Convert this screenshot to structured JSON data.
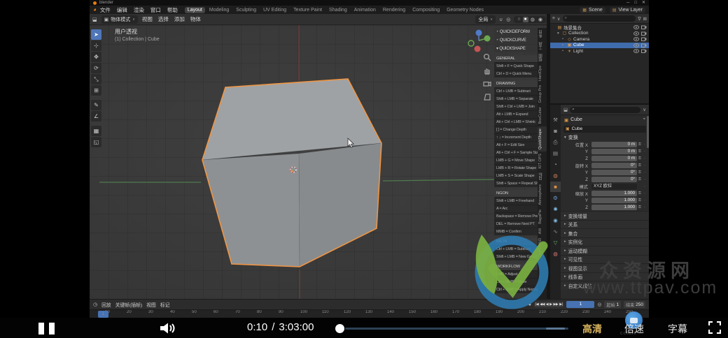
{
  "colors": {
    "accent_blue": "#4772b3",
    "selection_orange": "#ef9544",
    "axis_green": "#4f7a4f",
    "axis_red": "#703c3c",
    "hd_gold": "#d8b35c",
    "logo_blue": "#2e7db3",
    "logo_green": "#7cb342",
    "watermark_gray": "#3d3d3d"
  },
  "player": {
    "time_current": "0:10",
    "time_separator": "/",
    "time_total": "3:03:00",
    "hd_label": "高清",
    "speed_label": "倍速",
    "subtitles_label": "字幕",
    "cctalk_label": "cctalk"
  },
  "watermark": {
    "site_name": "众资源网",
    "site_url": "www.ttpav.com"
  },
  "blender": {
    "window": {
      "title": "blender",
      "buttons": [
        "─",
        "□",
        "✕"
      ]
    },
    "topbar": {
      "menus": [
        "文件",
        "编辑",
        "渲染",
        "窗口",
        "帮助"
      ],
      "workspaces": [
        {
          "label": "Layout",
          "cls": "active"
        },
        {
          "label": "Modeling"
        },
        {
          "label": "Sculpting"
        },
        {
          "label": "UV Editing"
        },
        {
          "label": "Texture Paint"
        },
        {
          "label": "Shading"
        },
        {
          "label": "Animation"
        },
        {
          "label": "Rendering"
        },
        {
          "label": "Compositing"
        },
        {
          "label": "Geometry Nodes"
        }
      ],
      "scene_label": "Scene",
      "view_layer_label": "View Layer"
    },
    "viewport_header": {
      "mode_label": "物体模式",
      "menus": [
        "视图",
        "选择",
        "添加",
        "物体"
      ],
      "orientation_label": "全局",
      "shading": [
        {
          "g": "○"
        },
        {
          "g": "●",
          "cls": "active"
        },
        {
          "g": "◍"
        },
        {
          "g": "◉"
        }
      ]
    },
    "viewport": {
      "overlay_line1": "用户透视",
      "overlay_line2": "(1) Collection | Cube",
      "tools": [
        {
          "g": "➤",
          "cls": "active"
        },
        {
          "g": "⊹"
        },
        {
          "g": "✥"
        },
        {
          "g": "⟳"
        },
        {
          "g": "⤡"
        },
        {
          "g": "⊞"
        },
        {
          "g": "✎",
          "cls": "gap"
        },
        {
          "g": "∠"
        },
        {
          "g": "▦",
          "cls": "gap"
        },
        {
          "g": "◱"
        }
      ]
    },
    "npanel": {
      "entries": [
        {
          "k": "tab",
          "t": "QUICKDEFORM"
        },
        {
          "k": "tab",
          "t": "QUICKCURVE"
        },
        {
          "k": "tabopen",
          "t": "QUICKSHAPE"
        },
        {
          "k": "h",
          "t": "GENERAL"
        },
        {
          "k": "i",
          "t": "Shift + F = Quick Shape"
        },
        {
          "k": "i",
          "t": "Ctrl + D = Quick Menu"
        },
        {
          "k": "h",
          "t": "DRAWING"
        },
        {
          "k": "i",
          "t": "Ctrl + LMB = Subtract"
        },
        {
          "k": "i",
          "t": "Shift + LMB = Separate"
        },
        {
          "k": "i",
          "t": "Shift + Ctrl + LMB = Join"
        },
        {
          "k": "i",
          "t": "Alt + LMB = Expand"
        },
        {
          "k": "i",
          "t": "Alt + Ctrl + LMB = Shrink"
        },
        {
          "k": "i",
          "t": "[ ] = Change Depth"
        },
        {
          "k": "i",
          "t": "↑ ↓ = Increment Depth"
        },
        {
          "k": "i",
          "t": "Alt + F = Edit Size"
        },
        {
          "k": "i",
          "t": "Alt + Ctrl + F = Sample Size"
        },
        {
          "k": "i",
          "t": "LMB + G = Move Shape"
        },
        {
          "k": "i",
          "t": "LMB + R = Rotate Shape"
        },
        {
          "k": "i",
          "t": "LMB + S = Scale Shape"
        },
        {
          "k": "i",
          "t": "Shift + Space = Repeat Shape"
        },
        {
          "k": "h",
          "t": "NGON"
        },
        {
          "k": "i",
          "t": "Shift + LMB = Freehand"
        },
        {
          "k": "i",
          "t": "A = Arc"
        },
        {
          "k": "i",
          "t": "Backspace = Remove Prev PT"
        },
        {
          "k": "i",
          "t": "DEL = Remove Next PT"
        },
        {
          "k": "i",
          "t": "MMB = Confirm"
        },
        {
          "k": "h",
          "t": "META"
        },
        {
          "k": "i",
          "t": "Ctrl + LMB = Subtract"
        },
        {
          "k": "i",
          "t": "Shift + LMB = New Group"
        },
        {
          "k": "h",
          "t": "WORKFLOW"
        },
        {
          "k": "i",
          "t": "LMB = Adjust"
        },
        {
          "k": "i",
          "t": "Ctrl + RMB = Move"
        },
        {
          "k": "i",
          "t": "Ctrl + RMB = Apply Normal"
        }
      ],
      "side_tabs": [
        {
          "label": "条目"
        },
        {
          "label": "工具"
        },
        {
          "label": "视图"
        },
        {
          "label": "HardOps"
        },
        {
          "label": "Group Pro"
        },
        {
          "label": "BoxCutter"
        },
        {
          "label": "QuickShape",
          "cls": "active"
        },
        {
          "label": "KIT OPS"
        },
        {
          "label": "目标"
        },
        {
          "label": "Atmosphere"
        },
        {
          "label": "BagaPie"
        },
        {
          "label": "AM"
        },
        {
          "label": "MACHIN3"
        }
      ]
    },
    "outliner": {
      "rows": [
        {
          "pre": "",
          "g": "▤",
          "name": "场景集合",
          "cls": "ind0"
        },
        {
          "pre": "▾",
          "g": "▢",
          "name": "Collection",
          "cls": "ind1"
        },
        {
          "pre": "•",
          "g": "◇",
          "name": "Camera",
          "cls": "ind2"
        },
        {
          "pre": "•",
          "g": "▣",
          "name": "Cube",
          "cls": "ind2 selected"
        },
        {
          "pre": "•",
          "g": "☀",
          "name": "Light",
          "cls": "ind2"
        }
      ]
    },
    "properties": {
      "tabs": [
        {
          "g": "⚒",
          "c": "#9a9a9a"
        },
        {
          "g": "◙",
          "c": "#9a9a9a"
        },
        {
          "g": "⎙",
          "c": "#9a9a9a"
        },
        {
          "g": "▤",
          "c": "#9a9a9a"
        },
        {
          "g": "◔",
          "c": "#b5b5b5"
        },
        {
          "g": "◍",
          "c": "#c77a5a"
        },
        {
          "g": "■",
          "c": "#e8903e",
          "cls": "active"
        },
        {
          "g": "⚙",
          "c": "#6f9fd8"
        },
        {
          "g": "✺",
          "c": "#7fb8e0"
        },
        {
          "g": "◉",
          "c": "#7fb8e0"
        },
        {
          "g": "∿",
          "c": "#9a9a9a"
        },
        {
          "g": "▽",
          "c": "#66b06a"
        },
        {
          "g": "◍",
          "c": "#d97777"
        }
      ],
      "breadcrumb": "Cube",
      "name_value": "Cube",
      "transform_label": "变换",
      "rows": [
        {
          "label": "位置 X",
          "value": "0 m",
          "kind": "field"
        },
        {
          "label": "Y",
          "value": "0 m",
          "kind": "field"
        },
        {
          "label": "Z",
          "value": "0 m",
          "kind": "field"
        },
        {
          "label": "旋转 X",
          "value": "0°",
          "kind": "field"
        },
        {
          "label": "Y",
          "value": "0°",
          "kind": "field"
        },
        {
          "label": "Z",
          "value": "0°",
          "kind": "field"
        },
        {
          "label": "模式",
          "value": "XYZ 欧拉",
          "kind": "select"
        },
        {
          "label": "缩放 X",
          "value": "1.000",
          "kind": "field"
        },
        {
          "label": "Y",
          "value": "1.000",
          "kind": "field"
        },
        {
          "label": "Z",
          "value": "1.000",
          "kind": "field"
        }
      ],
      "sections": [
        "变换增量",
        "关系",
        "集合",
        "实例化",
        "运动模糊",
        "可见性",
        "视图显示",
        "线条画",
        "自定义属性"
      ]
    },
    "timeline": {
      "playback_label": "回放",
      "keying_label": "关键帧(插帧)",
      "view_label": "视图",
      "marker_label": "标记",
      "transport": [
        "|◀",
        "◀◀",
        "◀",
        "▶",
        "▶▶",
        "▶|"
      ],
      "current_frame": "1",
      "start_label": "起始",
      "start_value": "1",
      "end_label": "结束",
      "end_value": "250",
      "ruler": [
        "10",
        "20",
        "30",
        "40",
        "50",
        "60",
        "70",
        "80",
        "90",
        "100",
        "110",
        "120",
        "130",
        "140",
        "150",
        "160",
        "170",
        "180",
        "190",
        "200",
        "210",
        "220",
        "230",
        "240",
        "250"
      ]
    }
  },
  "icons": {
    "caret": "∨",
    "magnet": "∪",
    "proportional": "◎",
    "editor": "⬓",
    "mode_cube": "▣",
    "clock": "◷",
    "record": "●",
    "keying": "◎",
    "search": "⌕",
    "funnel": "∇",
    "display": "≡",
    "add_collection": "⊞",
    "pin": "⌖"
  }
}
